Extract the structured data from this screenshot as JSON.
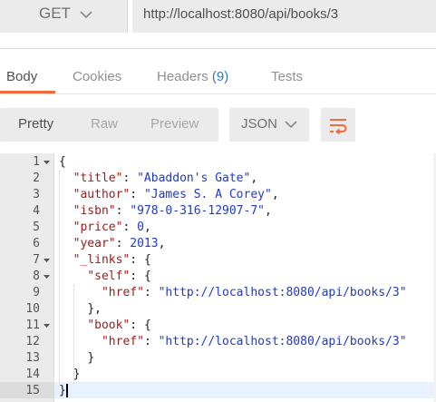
{
  "request": {
    "method": "GET",
    "url": "http://localhost:8080/api/books/3"
  },
  "tabs": [
    {
      "label": "Body",
      "active": true
    },
    {
      "label": "Cookies",
      "active": false
    },
    {
      "label": "Headers",
      "count": "(9)",
      "active": false
    },
    {
      "label": "Tests",
      "active": false
    }
  ],
  "view_modes": [
    {
      "label": "Pretty",
      "active": true
    },
    {
      "label": "Raw",
      "active": false
    },
    {
      "label": "Preview",
      "active": false
    }
  ],
  "format": {
    "selected": "JSON"
  },
  "icons": {
    "method_dropdown": "chevron-down-icon",
    "format_dropdown": "chevron-down-icon",
    "wrap_toggle": "wrap-lines-icon",
    "fold": "caret-down-icon"
  },
  "colors": {
    "accent": "#f26b3a",
    "count": "#2f78c4",
    "json_key": "#a11a1a",
    "json_value": "#1f39c8",
    "active_line": "#e8f2fe"
  },
  "editor": {
    "active_line": 15,
    "lines": [
      {
        "n": "1",
        "fold": true,
        "code": "{"
      },
      {
        "n": "2",
        "fold": false,
        "code": "  \"title\": \"Abaddon's Gate\","
      },
      {
        "n": "3",
        "fold": false,
        "code": "  \"author\": \"James S. A Corey\","
      },
      {
        "n": "4",
        "fold": false,
        "code": "  \"isbn\": \"978-0-316-12907-7\","
      },
      {
        "n": "5",
        "fold": false,
        "code": "  \"price\": 0,"
      },
      {
        "n": "6",
        "fold": false,
        "code": "  \"year\": 2013,"
      },
      {
        "n": "7",
        "fold": true,
        "code": "  \"_links\": {"
      },
      {
        "n": "8",
        "fold": true,
        "code": "    \"self\": {"
      },
      {
        "n": "9",
        "fold": false,
        "code": "      \"href\": \"http://localhost:8080/api/books/3\""
      },
      {
        "n": "10",
        "fold": false,
        "code": "    },"
      },
      {
        "n": "11",
        "fold": true,
        "code": "    \"book\": {"
      },
      {
        "n": "12",
        "fold": false,
        "code": "      \"href\": \"http://localhost:8080/api/books/3\""
      },
      {
        "n": "13",
        "fold": false,
        "code": "    }"
      },
      {
        "n": "14",
        "fold": false,
        "code": "  }"
      },
      {
        "n": "15",
        "fold": false,
        "code": "}"
      }
    ]
  }
}
